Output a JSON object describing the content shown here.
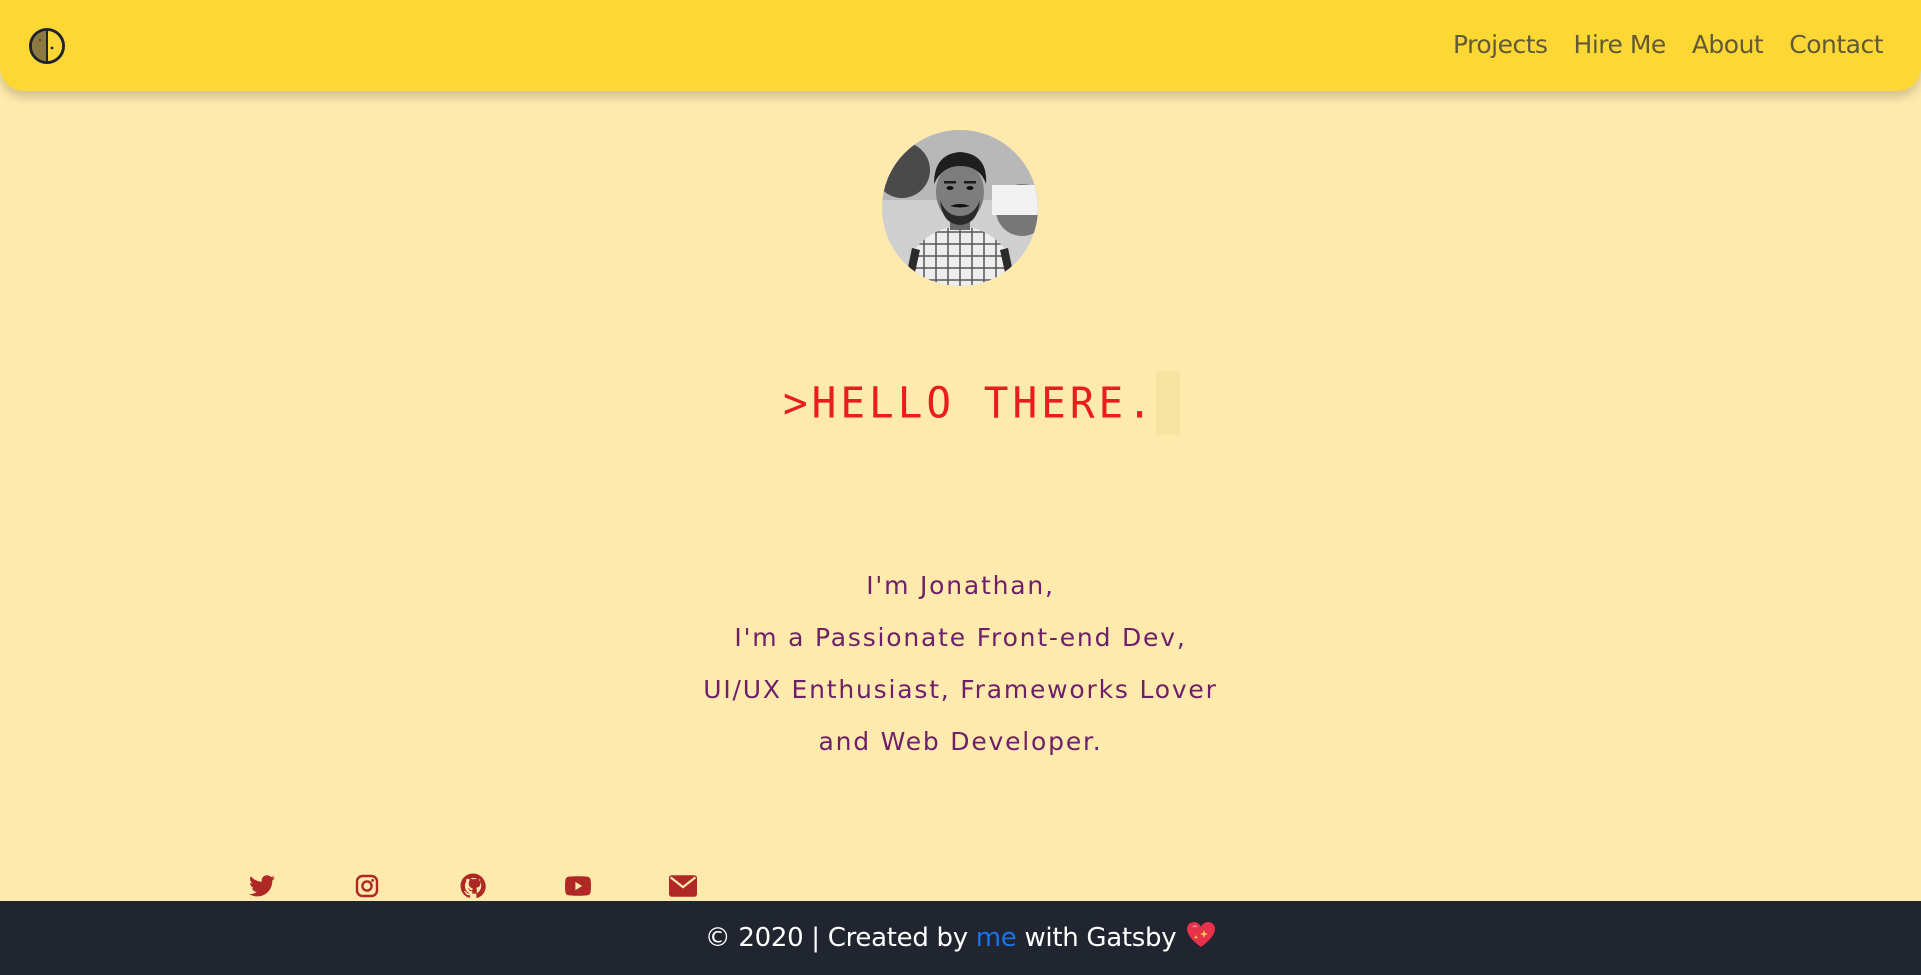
{
  "header": {
    "nav": [
      {
        "label": "Projects"
      },
      {
        "label": "Hire Me"
      },
      {
        "label": "About"
      },
      {
        "label": "Contact"
      }
    ],
    "toggle_icon": "half-moon-icon"
  },
  "hero": {
    "avatar_icon": "profile-photo",
    "greeting": ">HELLO THERE."
  },
  "intro": {
    "lines": [
      "I'm Jonathan,",
      "I'm a Passionate Front-end Dev,",
      "UI/UX Enthusiast, Frameworks Lover",
      "and Web Developer."
    ]
  },
  "social": {
    "icons": [
      "twitter-icon",
      "instagram-icon",
      "github-icon",
      "youtube-icon",
      "email-icon"
    ]
  },
  "footer": {
    "prefix": "© 2020 | Created by",
    "link": "me",
    "suffix": "with Gatsby",
    "heart_icon": "sparkling-heart-icon"
  },
  "colors": {
    "header_bg": "#fdd835",
    "page_bg": "#ffeaad",
    "greeting": "#ea1c1c",
    "intro_text": "#6d1f6a",
    "social_icon": "#b02826",
    "footer_bg": "#20252f",
    "link": "#1a73e8"
  }
}
